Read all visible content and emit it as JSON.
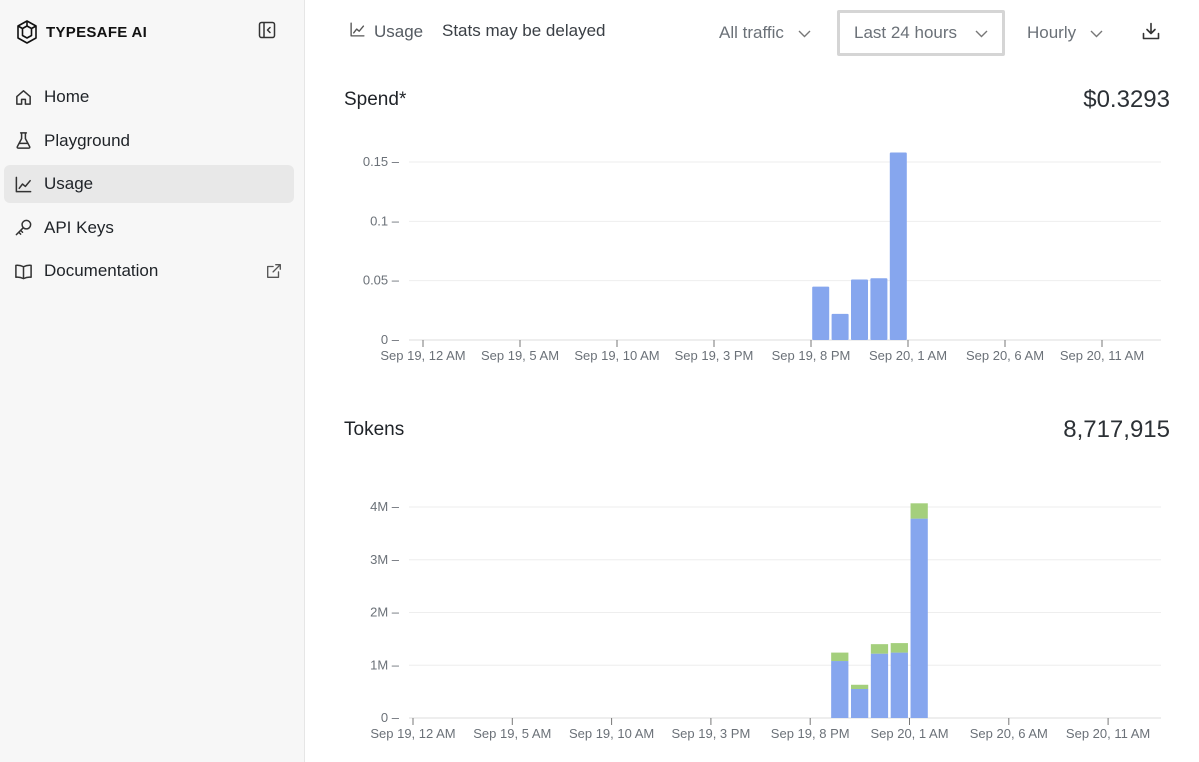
{
  "brand": {
    "name": "TYPESAFE AI",
    "logo_icon": "hexagon-logo-icon"
  },
  "sidebar": {
    "collapse_icon": "sidebar-collapse-icon",
    "items": [
      {
        "label": "Home",
        "icon": "home-icon",
        "active": false
      },
      {
        "label": "Playground",
        "icon": "flask-icon",
        "active": false
      },
      {
        "label": "Usage",
        "icon": "line-chart-icon",
        "active": true
      },
      {
        "label": "API Keys",
        "icon": "key-icon",
        "active": false
      },
      {
        "label": "Documentation",
        "icon": "book-icon",
        "active": false,
        "external_icon": "external-link-icon"
      }
    ]
  },
  "header": {
    "breadcrumb_label": "Usage",
    "status_text": "Stats may be delayed",
    "traffic_filter": "All traffic",
    "time_range": "Last 24 hours",
    "granularity": "Hourly",
    "download_icon": "download-icon"
  },
  "spend": {
    "title": "Spend*",
    "total": "$0.3293"
  },
  "tokens": {
    "title": "Tokens",
    "total": "8,717,915"
  },
  "colors": {
    "primary_bar": "#86a6ee",
    "secondary_bar": "#a4cf7c",
    "active_nav": "#e8e8e8"
  },
  "chart_data": [
    {
      "type": "bar",
      "name": "Spend*",
      "x_ticks": [
        "Sep 19, 12 AM",
        "Sep 19, 5 AM",
        "Sep 19, 10 AM",
        "Sep 19, 3 PM",
        "Sep 19, 8 PM",
        "Sep 20, 1 AM",
        "Sep 20, 6 AM",
        "Sep 20, 11 AM"
      ],
      "y_ticks": [
        "0",
        "0.05",
        "0.1",
        "0.15"
      ],
      "ylim": [
        0,
        0.15
      ],
      "bars": [
        {
          "slot": 20,
          "value": 0.045
        },
        {
          "slot": 21,
          "value": 0.022
        },
        {
          "slot": 22,
          "value": 0.051
        },
        {
          "slot": 23,
          "value": 0.052
        },
        {
          "slot": 24,
          "value": 0.158
        }
      ],
      "color": "#86a6ee"
    },
    {
      "type": "bar",
      "name": "Tokens",
      "stacked": true,
      "x_ticks": [
        "Sep 19, 12 AM",
        "Sep 19, 5 AM",
        "Sep 19, 10 AM",
        "Sep 19, 3 PM",
        "Sep 19, 8 PM",
        "Sep 20, 1 AM",
        "Sep 20, 6 AM",
        "Sep 20, 11 AM"
      ],
      "y_ticks": [
        "0",
        "1M",
        "2M",
        "3M",
        "4M"
      ],
      "ylim": [
        0,
        4000000
      ],
      "bars": [
        {
          "slot": 21,
          "primary": 1080000,
          "secondary": 160000
        },
        {
          "slot": 22,
          "primary": 550000,
          "secondary": 80000
        },
        {
          "slot": 23,
          "primary": 1220000,
          "secondary": 180000
        },
        {
          "slot": 24,
          "primary": 1240000,
          "secondary": 180000
        },
        {
          "slot": 25,
          "primary": 3780000,
          "secondary": 290000
        }
      ],
      "colors": [
        "#86a6ee",
        "#a4cf7c"
      ]
    }
  ]
}
